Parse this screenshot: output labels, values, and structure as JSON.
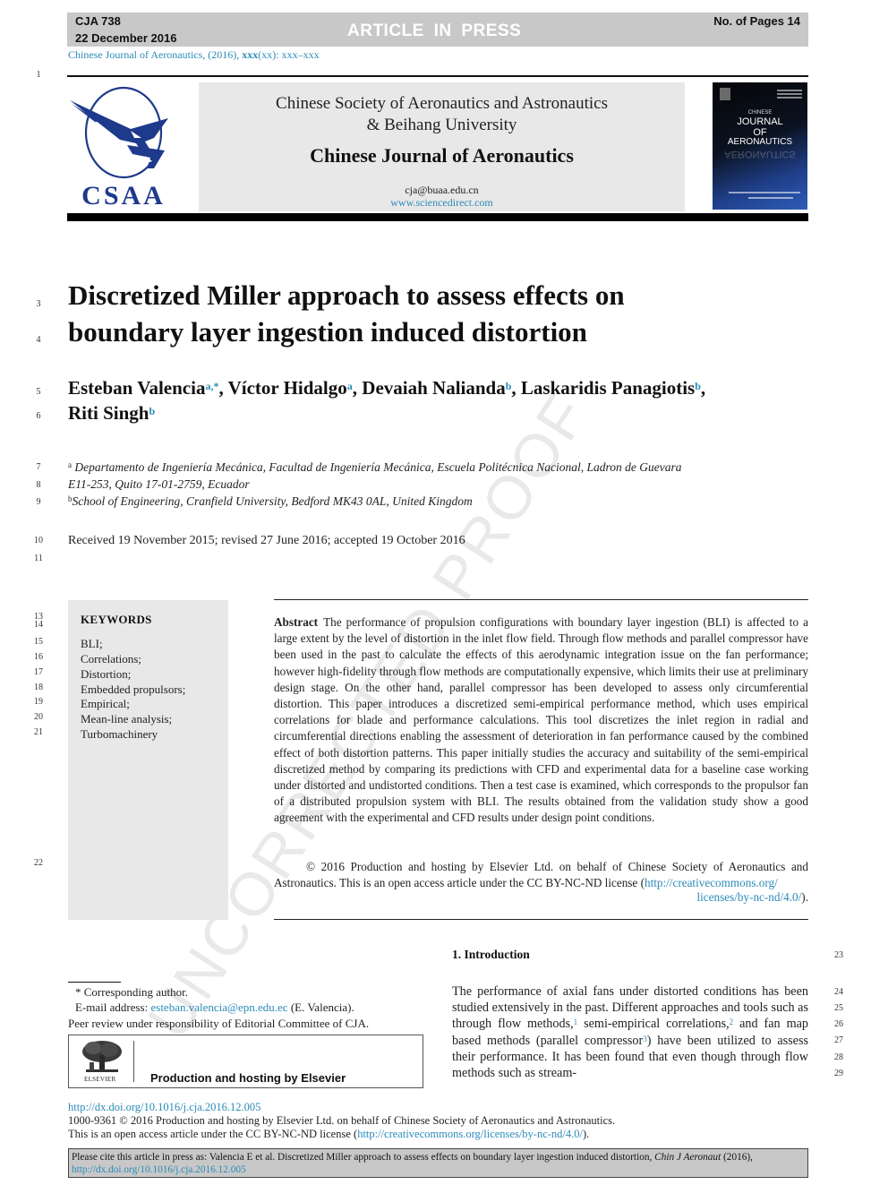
{
  "header": {
    "article_code": "CJA 738",
    "date": "22 December 2016",
    "status_banner": "ARTICLE IN PRESS",
    "page_count": "No. of Pages 14",
    "journal_ref_prefix": "Chinese Journal of Aeronautics, (2016), ",
    "journal_ref_volume": "xxx",
    "journal_ref_suffix": "(xx): xxx–xxx"
  },
  "masthead": {
    "logo_text": "CSAA",
    "society_line1": "Chinese Society of Aeronautics and Astronautics",
    "society_line2": "& Beihang University",
    "journal_name": "Chinese Journal of Aeronautics",
    "email": "cja@buaa.edu.cn",
    "website": "www.sciencedirect.com",
    "cover": {
      "top_word": "CHINESE",
      "line1": "JOURNAL",
      "line2": "OF",
      "line3": "AERONAUTICS"
    }
  },
  "watermark": "UNCORRECTED PROOF",
  "line_numbers": {
    "l1": "1",
    "l3": "3",
    "l4": "4",
    "l5": "5",
    "l6": "6",
    "l7": "7",
    "l8": "8",
    "l9": "9",
    "l10": "10",
    "l11": "11",
    "l13": "13",
    "l14": "14",
    "l15": "15",
    "l16": "16",
    "l17": "17",
    "l18": "18",
    "l19": "19",
    "l20": "20",
    "l21": "21",
    "l22": "22",
    "l23": "23",
    "l24": "24",
    "l25": "25",
    "l26": "26",
    "l27": "27",
    "l28": "28",
    "l29": "29"
  },
  "article": {
    "title_line1": "Discretized Miller approach to assess effects on",
    "title_line2": "boundary layer ingestion induced distortion",
    "authors": [
      {
        "name": "Esteban Valencia",
        "sup": "a,*",
        "sep": ", "
      },
      {
        "name": "Víctor Hidalgo",
        "sup": "a",
        "sep": ", "
      },
      {
        "name": "Devaiah Nalianda",
        "sup": "b",
        "sep": ", "
      },
      {
        "name": "Laskaridis Panagiotis",
        "sup": "b",
        "sep": ","
      },
      {
        "name": "Riti Singh",
        "sup": "b",
        "sep": ""
      }
    ],
    "affiliations": {
      "a_label": "a",
      "a_line1": "Departamento de Ingeniería Mecánica, Facultad de Ingeniería Mecánica, Escuela Politécnica Nacional, Ladron de Guevara",
      "a_line2": "E11-253, Quito 17-01-2759, Ecuador",
      "b_label": "b",
      "b_line1": "School of Engineering, Cranfield University, Bedford MK43 0AL, United Kingdom"
    },
    "received": "Received 19 November 2015; revised 27 June 2016; accepted 19 October 2016"
  },
  "keywords": {
    "heading": "KEYWORDS",
    "items": [
      "BLI;",
      "Correlations;",
      "Distortion;",
      "Embedded propulsors;",
      "Empirical;",
      "Mean-line analysis;",
      "Turbomachinery"
    ]
  },
  "abstract": {
    "label": "Abstract",
    "text": "The performance of propulsion configurations with boundary layer ingestion (BLI) is affected to a large extent by the level of distortion in the inlet flow field. Through flow methods and parallel compressor have been used in the past to calculate the effects of this aerodynamic integration issue on the fan performance; however high-fidelity through flow methods are computationally expensive, which limits their use at preliminary design stage. On the other hand, parallel compressor has been developed to assess only circumferential distortion. This paper introduces a discretized semi-empirical performance method, which uses empirical correlations for blade and performance calculations. This tool discretizes the inlet region in radial and circumferential directions enabling the assessment of deterioration in fan performance caused by the combined effect of both distortion patterns. This paper initially studies the accuracy and suitability of the semi-empirical discretized method by comparing its predictions with CFD and experimental data for a baseline case working under distorted and undistorted conditions. Then a test case is examined, which corresponds to the propulsor fan of a distributed propulsion system with BLI. The results obtained from the validation study show a good agreement with the experimental and CFD results under design point conditions.",
    "copyright_text": "© 2016 Production and hosting by Elsevier Ltd. on behalf of Chinese Society of Aeronautics and Astronautics. This is an open access article under the CC BY-NC-ND license (",
    "license_link_part1": "http://creativecommons.org/",
    "license_link_part2": "licenses/by-nc-nd/4.0/",
    "closing": ")."
  },
  "introduction": {
    "heading": "1. Introduction",
    "seg1": "The performance of axial fans under distorted conditions has been studied extensively in the past. Different approaches and tools such as through flow methods,",
    "ref1": "1",
    "seg2": " semi-empirical correlations,",
    "ref2": "2",
    "seg3": " and fan map based methods (parallel compressor",
    "ref3": "3",
    "seg4": ") have been utilized to assess their performance. It has been found that even though through flow methods such as stream-"
  },
  "footnotes": {
    "star": "*",
    "corresponding": "Corresponding author.",
    "email_label": "E-mail address: ",
    "email": "esteban.valencia@epn.edu.ec",
    "email_owner": " (E. Valencia).",
    "peer_review": "Peer review under responsibility of Editorial Committee of CJA.",
    "elsevier_logo_text": "ELSEVIER",
    "production": "Production and hosting by Elsevier"
  },
  "footer": {
    "doi": "http://dx.doi.org/10.1016/j.cja.2016.12.005",
    "issn_line": "1000-9361 © 2016 Production and hosting by Elsevier Ltd. on behalf of Chinese Society of Aeronautics and Astronautics.",
    "oa_prefix": "This is an open access article under the CC BY-NC-ND license (",
    "oa_link": "http://creativecommons.org/licenses/by-nc-nd/4.0/",
    "oa_suffix": ").",
    "cite_prefix": "Please cite this article in press as: Valencia E et al. Discretized Miller approach to assess effects on boundary layer ingestion induced distortion, ",
    "cite_journal": "Chin J Aeronaut",
    "cite_year": " (2016),",
    "cite_doi": "http://dx.doi.org/10.1016/j.cja.2016.12.005"
  },
  "colors": {
    "link": "#2a8bb8",
    "banner_gray": "#c8c8c8",
    "masthead_gray": "#e8e8e8",
    "logo_blue": "#1e3a8c"
  }
}
